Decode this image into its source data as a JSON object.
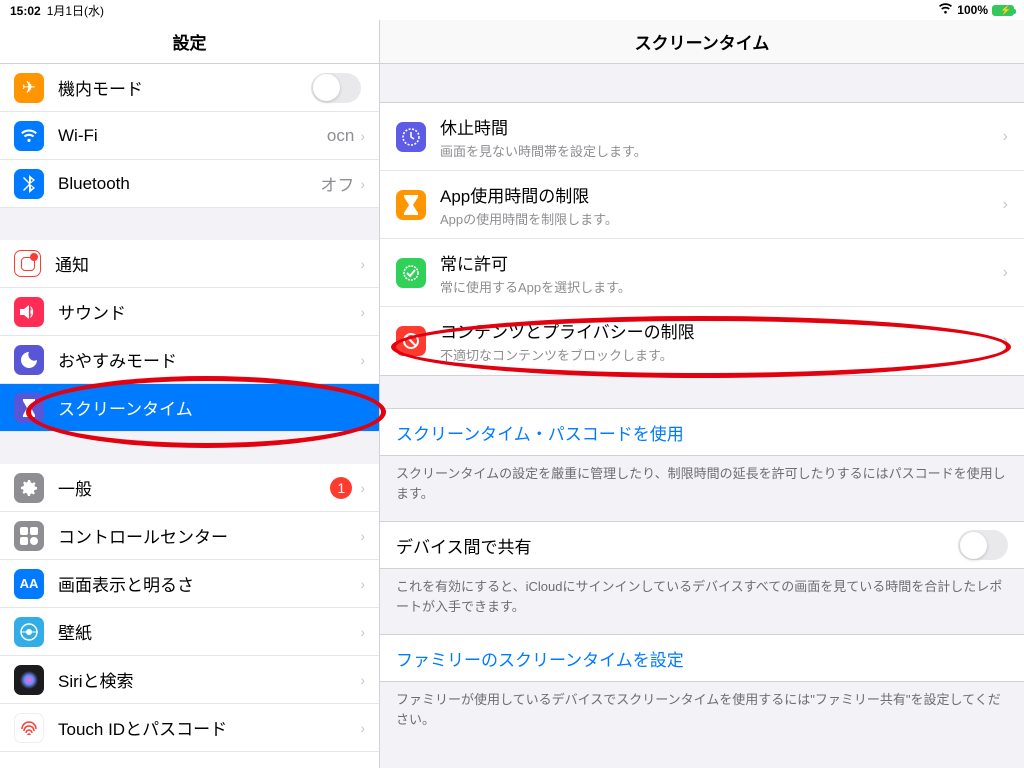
{
  "statusbar": {
    "time": "15:02",
    "date": "1月1日(水)",
    "battery": "100%"
  },
  "sidebar": {
    "title": "設定",
    "items": [
      {
        "label": "機内モード"
      },
      {
        "label": "Wi-Fi",
        "value": "ocn"
      },
      {
        "label": "Bluetooth",
        "value": "オフ"
      },
      {
        "label": "通知"
      },
      {
        "label": "サウンド"
      },
      {
        "label": "おやすみモード"
      },
      {
        "label": "スクリーンタイム"
      },
      {
        "label": "一般",
        "badge": "1"
      },
      {
        "label": "コントロールセンター"
      },
      {
        "label": "画面表示と明るさ"
      },
      {
        "label": "壁紙"
      },
      {
        "label": "Siriと検索"
      },
      {
        "label": "Touch IDとパスコード"
      }
    ]
  },
  "detail": {
    "title": "スクリーンタイム",
    "group1": [
      {
        "title": "休止時間",
        "sub": "画面を見ない時間帯を設定します。",
        "icon": "clock-icon",
        "bg": "bg-violet"
      },
      {
        "title": "App使用時間の制限",
        "sub": "Appの使用時間を制限します。",
        "icon": "hourglass-icon",
        "bg": "bg-orange"
      },
      {
        "title": "常に許可",
        "sub": "常に使用するAppを選択します。",
        "icon": "check-icon",
        "bg": "bg-teal"
      },
      {
        "title": "コンテンツとプライバシーの制限",
        "sub": "不適切なコンテンツをブロックします。",
        "icon": "prohibited-icon",
        "bg": "bg-red"
      }
    ],
    "passcode": {
      "link": "スクリーンタイム・パスコードを使用",
      "note": "スクリーンタイムの設定を厳重に管理したり、制限時間の延長を許可したりするにはパスコードを使用します。"
    },
    "share": {
      "title": "デバイス間で共有",
      "note": "これを有効にすると、iCloudにサインインしているデバイスすべての画面を見ている時間を合計したレポートが入手できます。"
    },
    "family": {
      "link": "ファミリーのスクリーンタイムを設定",
      "note": "ファミリーが使用しているデバイスでスクリーンタイムを使用するには\"ファミリー共有\"を設定してください。"
    }
  }
}
